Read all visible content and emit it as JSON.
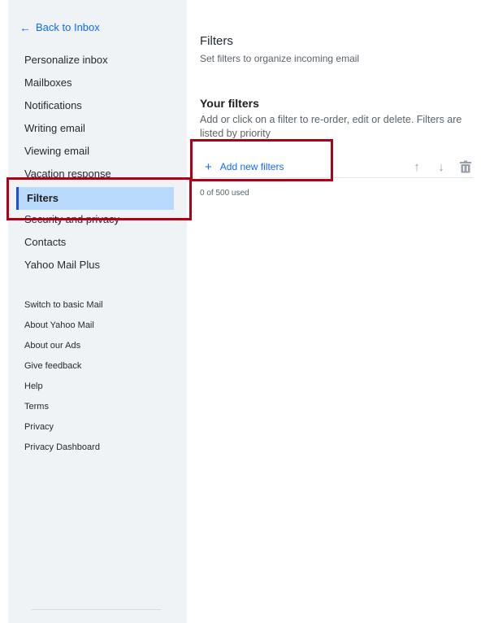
{
  "sidebar": {
    "back_label": "Back to Inbox",
    "back_icon": "arrow-left-icon",
    "items": [
      {
        "label": "Personalize inbox",
        "active": false
      },
      {
        "label": "Mailboxes",
        "active": false
      },
      {
        "label": "Notifications",
        "active": false
      },
      {
        "label": "Writing email",
        "active": false
      },
      {
        "label": "Viewing email",
        "active": false
      },
      {
        "label": "Vacation response",
        "active": false
      },
      {
        "label": "Filters",
        "active": true
      },
      {
        "label": "Security and privacy",
        "active": false
      },
      {
        "label": "Contacts",
        "active": false
      },
      {
        "label": "Yahoo Mail Plus",
        "active": false
      }
    ],
    "links": [
      "Switch to basic Mail",
      "About Yahoo Mail",
      "About our Ads",
      "Give feedback",
      "Help",
      "Terms",
      "Privacy",
      "Privacy Dashboard"
    ]
  },
  "main": {
    "title": "Filters",
    "subtitle": "Set filters to organize incoming email",
    "section_title": "Your filters",
    "section_desc": "Add or click on a filter to re-order, edit or delete. Filters are listed by priority",
    "add_label": "Add new filters",
    "add_icon": "plus-icon",
    "toolbar_icons": [
      "arrow-up-icon",
      "arrow-down-icon",
      "trash-icon"
    ],
    "usage": "0 of 500 used"
  },
  "colors": {
    "accent": "#0f69ff",
    "sidebar_bg": "#f0f3f5",
    "active_bg": "#b9dafb",
    "highlight_border": "#b00018"
  }
}
